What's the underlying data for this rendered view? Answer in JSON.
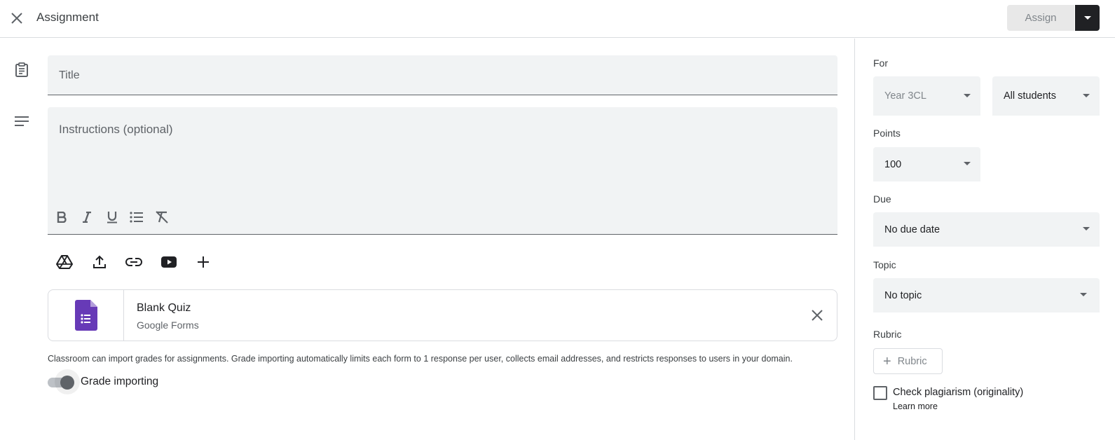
{
  "header": {
    "title": "Assignment",
    "assign_label": "Assign"
  },
  "form": {
    "title_placeholder": "Title",
    "instructions_placeholder": "Instructions (optional)"
  },
  "attachment": {
    "name": "Blank Quiz",
    "type": "Google Forms"
  },
  "grade_importing": {
    "note": "Classroom can import grades for assignments. Grade importing automatically limits each form to 1 response per user, collects email addresses, and restricts responses to users in your domain.",
    "label": "Grade importing",
    "enabled": false
  },
  "settings": {
    "for_label": "For",
    "class_value": "Year 3CL",
    "students_value": "All students",
    "points_label": "Points",
    "points_value": "100",
    "due_label": "Due",
    "due_value": "No due date",
    "topic_label": "Topic",
    "topic_value": "No topic",
    "rubric_label": "Rubric",
    "rubric_button": "Rubric",
    "plagiarism_label": "Check plagiarism (originality)",
    "learn_more": "Learn more"
  },
  "colors": {
    "forms_purple": "#673ab7",
    "field_bg": "#f1f3f4",
    "divider": "#dadce0"
  }
}
